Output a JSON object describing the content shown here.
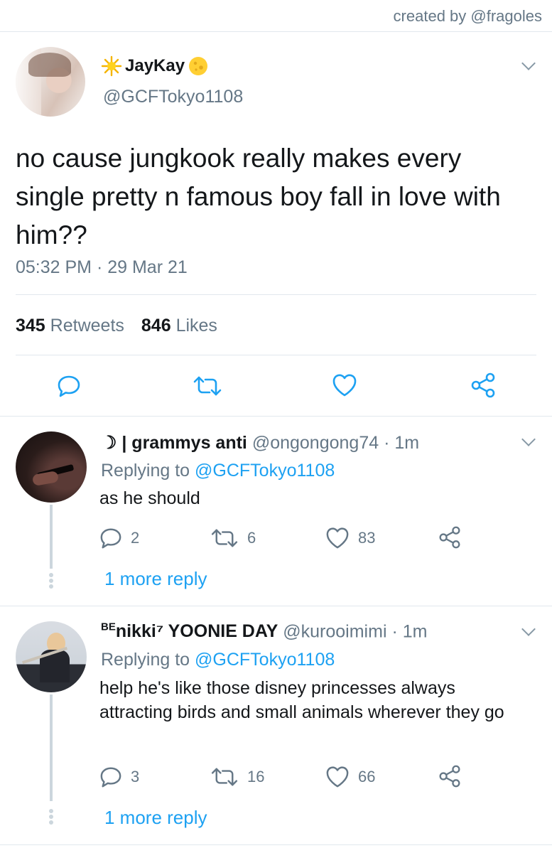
{
  "credit": "created by @fragoles",
  "tweet": {
    "name": "JayKay",
    "handle": "@GCFTokyo1108",
    "text": "no cause jungkook really makes every single pretty n famous boy fall in love with him??",
    "time": "05:32 PM · 29 Mar 21",
    "retweets": "345",
    "retweets_label": "Retweets",
    "likes": "846",
    "likes_label": "Likes",
    "icons": [
      "reply-icon",
      "retweet-icon",
      "like-icon",
      "share-icon"
    ]
  },
  "replies": [
    {
      "name": "☽ | grammys anti",
      "handle": "@ongongong74 · 1m",
      "replying_to_label": "Replying to",
      "replying_to": "@GCFTokyo1108",
      "text": "as he should",
      "reply_count": "2",
      "retweet_count": "6",
      "like_count": "83",
      "more": "1 more reply"
    },
    {
      "name_prefix": "BE",
      "name": "nikki⁷ YOONIE DAY",
      "handle": "@kurooimimi · 1m",
      "replying_to_label": "Replying to",
      "replying_to": "@GCFTokyo1108",
      "text": "help he's like those disney princesses always attracting birds and small animals wherever they go",
      "reply_count": "3",
      "retweet_count": "16",
      "like_count": "66",
      "more": "1 more reply"
    }
  ],
  "colors": {
    "link": "#1da1f2",
    "secondary_text": "#657786",
    "primary_text": "#14171a",
    "divider": "#e1e8ed"
  }
}
